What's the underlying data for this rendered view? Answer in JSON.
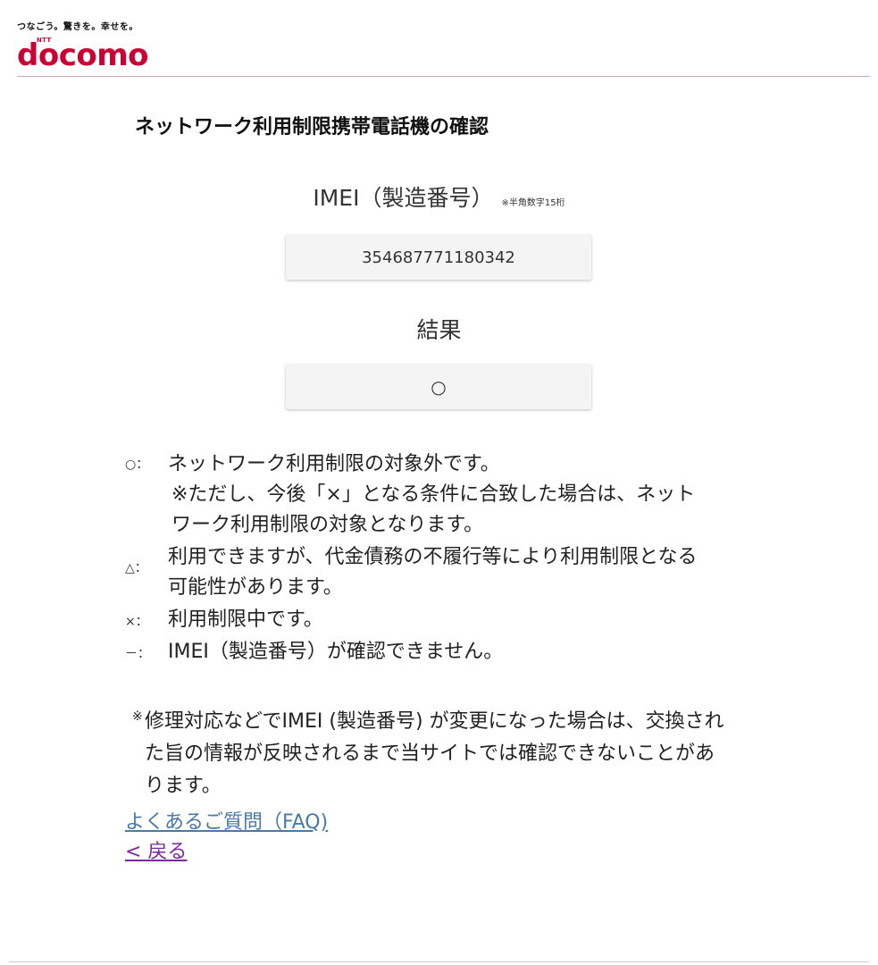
{
  "header": {
    "tagline": "つなごう。驚きを。幸せを。",
    "logo_mark": "NTT",
    "logo_text": "docomo",
    "brand_color": "#cc0033"
  },
  "page_title": "ネットワーク利用制限携帯電話機の確認",
  "imei": {
    "label": "IMEI（製造番号）",
    "note": "※半角数字15桁",
    "value": "354687771180342"
  },
  "result": {
    "label": "結果",
    "value": "○"
  },
  "legend": [
    {
      "symbol": "○：",
      "lines": [
        "ネットワーク利用制限の対象外です。",
        "※ただし、今後「×」となる条件に合致した場合は、ネット",
        "ワーク利用制限の対象となります。"
      ]
    },
    {
      "symbol": "△：",
      "lines": [
        "利用できますが、代金債務の不履行等により利用制限となる",
        "可能性があります。"
      ]
    },
    {
      "symbol": "×：",
      "lines": [
        "利用制限中です。"
      ]
    },
    {
      "symbol": "－：",
      "lines": [
        "IMEI（製造番号）が確認できません。"
      ]
    }
  ],
  "footnote": {
    "mark": "※",
    "lines": [
      "修理対応などでIMEI (製造番号) が変更になった場合は、交換され",
      "た旨の情報が反映されるまで当サイトでは確認できないことがあ",
      "ります。"
    ]
  },
  "links": {
    "faq": "よくあるご質問（FAQ)",
    "back": "< 戻る"
  }
}
